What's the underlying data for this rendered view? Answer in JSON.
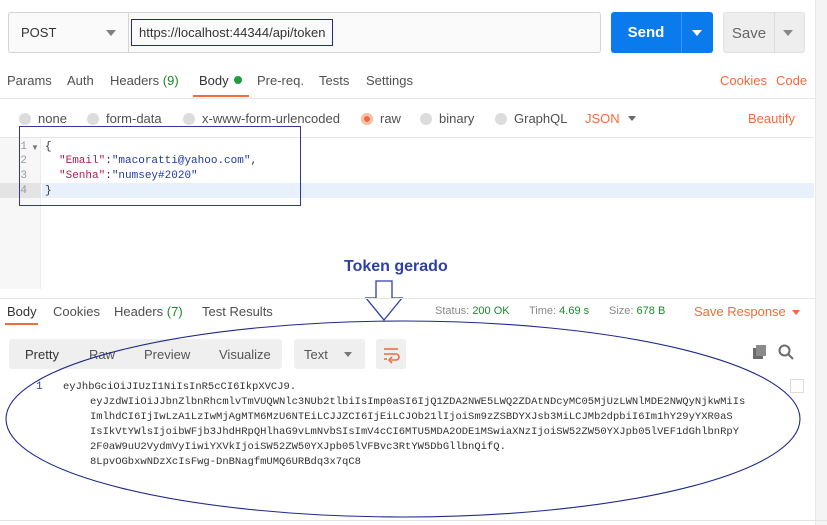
{
  "request": {
    "method": "POST",
    "url": "https://localhost:44344/api/token",
    "send_label": "Send",
    "save_label": "Save"
  },
  "request_tabs": {
    "params": "Params",
    "auth": "Auth",
    "headers": "Headers",
    "headers_count": "(9)",
    "body": "Body",
    "prereq": "Pre-req.",
    "tests": "Tests",
    "settings": "Settings",
    "cookies": "Cookies",
    "code": "Code"
  },
  "body_types": {
    "none": "none",
    "form_data": "form-data",
    "urlencoded": "x-www-form-urlencoded",
    "raw": "raw",
    "binary": "binary",
    "graphql": "GraphQL",
    "selected": "raw",
    "format": "JSON",
    "beautify": "Beautify"
  },
  "editor": {
    "line_numbers": [
      "1",
      "2",
      "3",
      "4"
    ],
    "line1": "{",
    "line2_key": "\"Email\"",
    "line2_val": "\"macoratti@yahoo.com\"",
    "line3_key": "\"Senha\"",
    "line3_val": "\"numsey#2020\"",
    "line4": "}"
  },
  "annotation": {
    "label": "Token gerado"
  },
  "response": {
    "tabs": {
      "body": "Body",
      "cookies": "Cookies",
      "headers": "Headers",
      "headers_count": "(7)",
      "test_results": "Test Results"
    },
    "status_label": "Status:",
    "status_value": "200 OK",
    "time_label": "Time:",
    "time_value": "4.69 s",
    "size_label": "Size:",
    "size_value": "678 B",
    "save_response": "Save Response",
    "views": {
      "pretty": "Pretty",
      "raw": "Raw",
      "preview": "Preview",
      "visualize": "Visualize"
    },
    "format": "Text",
    "line_number": "1",
    "token_lines": [
      "eyJhbGciOiJIUzI1NiIsInR5cCI6IkpXVCJ9.",
      "eyJzdWIiOiJJbnZlbnRhcmlvTmVUQWNlc3NUb2tlbiIsImp0aSI6IjQ1ZDA2NWE5LWQ2ZDAtNDcyMC05MjUzLWNlMDE2NWQyNjkwMiIs",
      "ImlhdCI6IjIwLzA1LzIwMjAgMTM6MzU6NTEiLCJJZCI6IjEiLCJOb21lIjoiSm9zZSBDYXJsb3MiLCJMb2dpbiI6Im1hY29yYXR0aS",
      "IsIkVtYWlsIjoibWFjb3JhdHRpQHlhaG9vLmNvbSIsImV4cCI6MTU5MDA2ODE1MSwiaXNzIjoiSW52ZW50YXJpb05lVEF1dGhlbnRpY",
      "2F0aW9uU2VydmVyIiwiYXVkIjoiSW52ZW50YXJpb05lVFBvc3RtYW5DbGllbnQifQ.",
      "8LpvOGbxwNDzXcIsFwg-DnBNagfmUMQ6URBdq3x7qC8"
    ]
  },
  "colors": {
    "accent": "#f26b3a",
    "send_blue": "#097bed",
    "annotation_blue": "#2f3fa8",
    "success_green": "#1b8a2d"
  }
}
